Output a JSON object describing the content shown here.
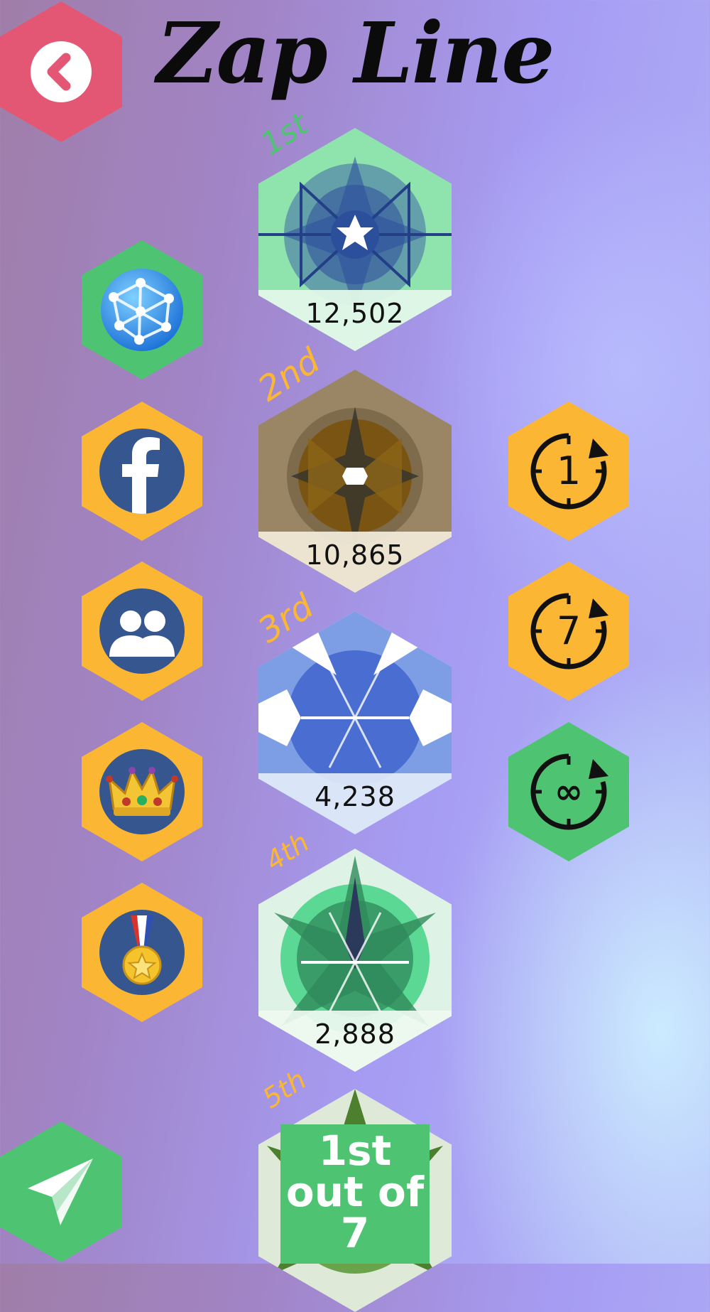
{
  "app": {
    "title": "Zap Line"
  },
  "nav": {
    "back_icon": "chevron-left-icon",
    "share_icon": "paper-plane-icon"
  },
  "leaderboard": [
    {
      "rank_label": "1st",
      "score": "12,502",
      "theme": "green"
    },
    {
      "rank_label": "2nd",
      "score": "10,865",
      "theme": "brown"
    },
    {
      "rank_label": "3rd",
      "score": "4,238",
      "theme": "blue"
    },
    {
      "rank_label": "4th",
      "score": "2,888",
      "theme": "mint"
    },
    {
      "rank_label": "5th",
      "score": "",
      "theme": "olive"
    }
  ],
  "scope_buttons": [
    {
      "icon": "globe-network-icon",
      "color": "#4ec372",
      "selected": true
    },
    {
      "icon": "facebook-icon",
      "color": "#fbb734",
      "selected": false
    },
    {
      "icon": "friends-icon",
      "color": "#fbb734",
      "selected": false
    },
    {
      "icon": "crown-icon",
      "color": "#fbb734",
      "selected": false
    },
    {
      "icon": "medal-icon",
      "color": "#fbb734",
      "selected": false
    }
  ],
  "period_buttons": [
    {
      "label": "1",
      "icon": "one-day-timer-icon",
      "color": "#fbb734",
      "selected": false
    },
    {
      "label": "7",
      "icon": "seven-day-timer-icon",
      "color": "#fbb734",
      "selected": false
    },
    {
      "label": "∞",
      "icon": "all-time-timer-icon",
      "color": "#4ec372",
      "selected": true
    }
  ],
  "result": {
    "line1": "1st",
    "line2": "out of",
    "line3": "7"
  },
  "colors": {
    "accent_green": "#4ec372",
    "accent_yellow": "#fbb734",
    "back_pink": "#e45774",
    "icon_navy": "#35568f"
  }
}
